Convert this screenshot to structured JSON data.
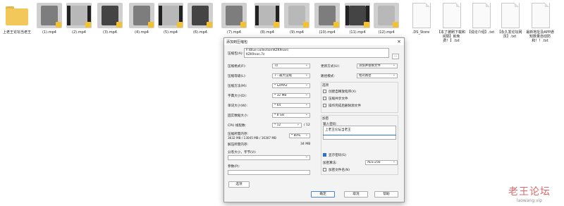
{
  "files": [
    {
      "kind": "folder",
      "name": "上老王论坛当老王"
    },
    {
      "kind": "video",
      "name": "(1).mp4",
      "tone": "mid"
    },
    {
      "kind": "video",
      "name": "(2).mp4",
      "tone": "light"
    },
    {
      "kind": "video",
      "name": "(3).mp4",
      "tone": "dark"
    },
    {
      "kind": "video",
      "name": "(4).mp4",
      "tone": "mid"
    },
    {
      "kind": "video",
      "name": "(5).mp4",
      "tone": "light"
    },
    {
      "kind": "video",
      "name": "(6).mp4",
      "tone": "dark"
    },
    {
      "kind": "video",
      "name": "(7).mp4",
      "tone": "mid"
    },
    {
      "kind": "video",
      "name": "(8).mp4",
      "tone": "light"
    },
    {
      "kind": "video",
      "name": "(9).mp4",
      "tone": "light"
    },
    {
      "kind": "video",
      "name": "(10).mp4",
      "tone": "mid"
    },
    {
      "kind": "video",
      "name": "(11).mp4",
      "tone": "dark"
    },
    {
      "kind": "video",
      "name": "(12).mp4",
      "tone": "light"
    },
    {
      "kind": "doc",
      "name": ".DS_Store"
    },
    {
      "kind": "doc",
      "name": "【本了被刷下载和间隔】就免费！】.txt"
    },
    {
      "kind": "doc",
      "name": "【说论介绍】.txt"
    },
    {
      "kind": "doc",
      "name": "【永久发论坛网页】.txt"
    },
    {
      "kind": "doc",
      "name": "最新地址及APP通知数量自动防和！！.txt"
    }
  ],
  "dialog": {
    "title": "添加到压缩包",
    "close_icon": "close-icon",
    "archive_label": "压缩包(A):",
    "archive_dir": "F:\\Blue collection\\KZK9nan\\",
    "archive_name": "KZK9nan.7z",
    "browse_label": "...",
    "format_label": "压缩格式(F):",
    "format_value": "7z",
    "level_label": "压缩等级(L):",
    "level_value": "7 - 最大压缩",
    "method_label": "压缩方法(M):",
    "method_value": "* LZMA2",
    "dict_label": "字典大小(D):",
    "dict_value": "* 32 MB",
    "word_label": "单词大小(W):",
    "word_value": "* 64",
    "solid_label": "固实数据大小:",
    "solid_value": "* 8 GB",
    "cpu_label": "CPU 线程数:",
    "cpu_value": "* 12",
    "cpu_max": "/ 12",
    "mem_comp_label": "压缩所需内存:",
    "mem_comp_value": "3632 MB / 13045 MB / 16307 MB",
    "mem_percent": "* 80%",
    "mem_decomp_label": "解压所需内存:",
    "mem_decomp_value": "34 MB",
    "split_label": "分卷大小，字节(V):",
    "split_value": "",
    "params_label": "参数(P):",
    "params_value": "",
    "options_button": "选项",
    "update_label": "更新方式(U):",
    "update_value": "添加并替换文件",
    "path_label": "路径模式:",
    "path_value": "相对路径",
    "opts_title": "选项",
    "opt_sfx": "创建自释放程序(X)",
    "opt_shared": "压缩共享文件",
    "opt_delete": "操作完成后删除源文件",
    "enc_title": "加密",
    "enc_pw_label": "输入密码:",
    "enc_pw_value": "上老王论坛当老王",
    "enc_show_pw": "显示密码(S)",
    "enc_method_label": "加密算法:",
    "enc_method_value": "AES-256",
    "enc_names": "加密文件名(N)",
    "ok_button": "确定",
    "cancel_button": "取消",
    "help_button": "帮助"
  },
  "watermark": {
    "text_cn": "老王论坛",
    "url": "laowang.vip"
  },
  "colors": {
    "accent": "#2f6fcf",
    "folder": "#f2c85b",
    "watermark": "#d23a3a"
  }
}
